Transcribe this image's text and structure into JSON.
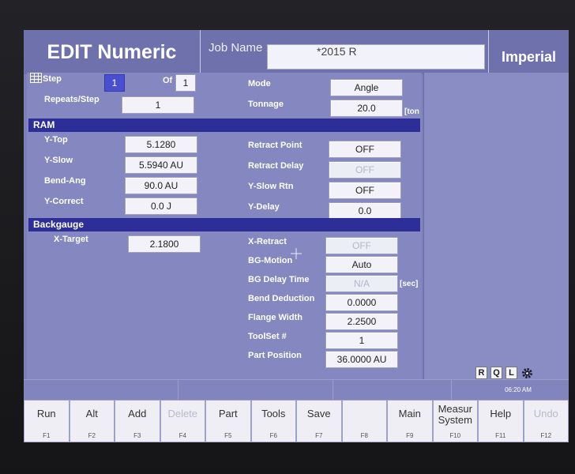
{
  "header": {
    "title": "EDIT Numeric",
    "job_label": "Job Name :",
    "job_value": "*2015 R",
    "units": "Imperial"
  },
  "step": {
    "label": "Step",
    "value": "1",
    "of_label": "Of",
    "of_value": "1",
    "repeats_label": "Repeats/Step",
    "repeats_value": "1",
    "mode_label": "Mode",
    "mode_value": "Angle",
    "tonnage_label": "Tonnage",
    "tonnage_value": "20.0",
    "tonnage_unit": "[ton"
  },
  "ram": {
    "title": "RAM",
    "y_top_label": "Y-Top",
    "y_top_value": "5.1280",
    "y_slow_label": "Y-Slow",
    "y_slow_value": "5.5940 AU",
    "bend_ang_label": "Bend-Ang",
    "bend_ang_value": "90.0 AU",
    "y_correct_label": "Y-Correct",
    "y_correct_value": "0.0 J",
    "retract_point_label": "Retract Point",
    "retract_point_value": "OFF",
    "retract_delay_label": "Retract Delay",
    "retract_delay_value": "OFF",
    "y_slow_rtn_label": "Y-Slow Rtn",
    "y_slow_rtn_value": "OFF",
    "y_delay_label": "Y-Delay",
    "y_delay_value": "0.0"
  },
  "backgauge": {
    "title": "Backgauge",
    "x_target_label": "X-Target",
    "x_target_value": "2.1800",
    "x_retract_label": "X-Retract",
    "x_retract_value": "OFF",
    "bg_motion_label": "BG-Motion",
    "bg_motion_value": "Auto",
    "bg_delay_label": "BG Delay Time",
    "bg_delay_value": "N/A",
    "bg_delay_unit": "[sec]",
    "bend_deduction_label": "Bend Deduction",
    "bend_deduction_value": "0.0000",
    "flange_width_label": "Flange Width",
    "flange_width_value": "2.2500",
    "toolset_label": "ToolSet #",
    "toolset_value": "1",
    "part_position_label": "Part Position",
    "part_position_value": "36.0000 AU"
  },
  "status": {
    "r": "R",
    "q": "Q",
    "l": "L",
    "time": "06:20 AM"
  },
  "fkeys": [
    {
      "label": "Run",
      "fn": "F1",
      "enabled": true
    },
    {
      "label": "Alt",
      "fn": "F2",
      "enabled": true
    },
    {
      "label": "Add",
      "fn": "F3",
      "enabled": true
    },
    {
      "label": "Delete",
      "fn": "F4",
      "enabled": false
    },
    {
      "label": "Part",
      "fn": "F5",
      "enabled": true
    },
    {
      "label": "Tools",
      "fn": "F6",
      "enabled": true
    },
    {
      "label": "Save",
      "fn": "F7",
      "enabled": true
    },
    {
      "label": "",
      "fn": "F8",
      "enabled": false
    },
    {
      "label": "Main",
      "fn": "F9",
      "enabled": true
    },
    {
      "label": "Measur System",
      "fn": "F10",
      "enabled": true
    },
    {
      "label": "Help",
      "fn": "F11",
      "enabled": true
    },
    {
      "label": "Undo",
      "fn": "F12",
      "enabled": false
    }
  ],
  "colors": {
    "background": "#7c7fb8",
    "section_bar": "#2d2e98",
    "field": "#f2f2f8",
    "selected_field": "#4a4fd0"
  }
}
